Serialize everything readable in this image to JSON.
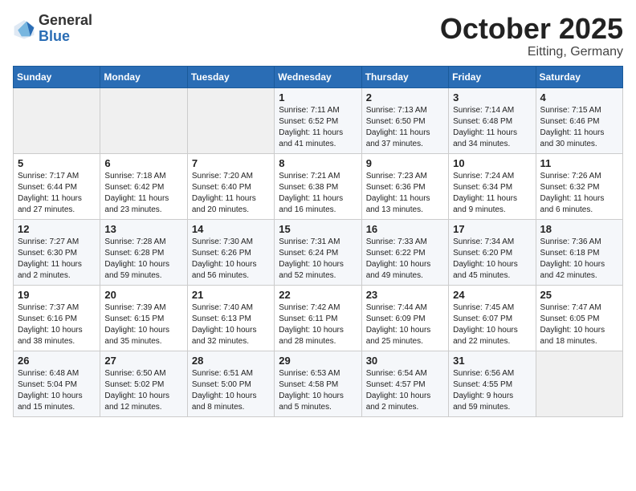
{
  "header": {
    "logo_general": "General",
    "logo_blue": "Blue",
    "month_title": "October 2025",
    "location": "Eitting, Germany"
  },
  "days_of_week": [
    "Sunday",
    "Monday",
    "Tuesday",
    "Wednesday",
    "Thursday",
    "Friday",
    "Saturday"
  ],
  "weeks": [
    [
      {
        "day": "",
        "info": ""
      },
      {
        "day": "",
        "info": ""
      },
      {
        "day": "",
        "info": ""
      },
      {
        "day": "1",
        "info": "Sunrise: 7:11 AM\nSunset: 6:52 PM\nDaylight: 11 hours\nand 41 minutes."
      },
      {
        "day": "2",
        "info": "Sunrise: 7:13 AM\nSunset: 6:50 PM\nDaylight: 11 hours\nand 37 minutes."
      },
      {
        "day": "3",
        "info": "Sunrise: 7:14 AM\nSunset: 6:48 PM\nDaylight: 11 hours\nand 34 minutes."
      },
      {
        "day": "4",
        "info": "Sunrise: 7:15 AM\nSunset: 6:46 PM\nDaylight: 11 hours\nand 30 minutes."
      }
    ],
    [
      {
        "day": "5",
        "info": "Sunrise: 7:17 AM\nSunset: 6:44 PM\nDaylight: 11 hours\nand 27 minutes."
      },
      {
        "day": "6",
        "info": "Sunrise: 7:18 AM\nSunset: 6:42 PM\nDaylight: 11 hours\nand 23 minutes."
      },
      {
        "day": "7",
        "info": "Sunrise: 7:20 AM\nSunset: 6:40 PM\nDaylight: 11 hours\nand 20 minutes."
      },
      {
        "day": "8",
        "info": "Sunrise: 7:21 AM\nSunset: 6:38 PM\nDaylight: 11 hours\nand 16 minutes."
      },
      {
        "day": "9",
        "info": "Sunrise: 7:23 AM\nSunset: 6:36 PM\nDaylight: 11 hours\nand 13 minutes."
      },
      {
        "day": "10",
        "info": "Sunrise: 7:24 AM\nSunset: 6:34 PM\nDaylight: 11 hours\nand 9 minutes."
      },
      {
        "day": "11",
        "info": "Sunrise: 7:26 AM\nSunset: 6:32 PM\nDaylight: 11 hours\nand 6 minutes."
      }
    ],
    [
      {
        "day": "12",
        "info": "Sunrise: 7:27 AM\nSunset: 6:30 PM\nDaylight: 11 hours\nand 2 minutes."
      },
      {
        "day": "13",
        "info": "Sunrise: 7:28 AM\nSunset: 6:28 PM\nDaylight: 10 hours\nand 59 minutes."
      },
      {
        "day": "14",
        "info": "Sunrise: 7:30 AM\nSunset: 6:26 PM\nDaylight: 10 hours\nand 56 minutes."
      },
      {
        "day": "15",
        "info": "Sunrise: 7:31 AM\nSunset: 6:24 PM\nDaylight: 10 hours\nand 52 minutes."
      },
      {
        "day": "16",
        "info": "Sunrise: 7:33 AM\nSunset: 6:22 PM\nDaylight: 10 hours\nand 49 minutes."
      },
      {
        "day": "17",
        "info": "Sunrise: 7:34 AM\nSunset: 6:20 PM\nDaylight: 10 hours\nand 45 minutes."
      },
      {
        "day": "18",
        "info": "Sunrise: 7:36 AM\nSunset: 6:18 PM\nDaylight: 10 hours\nand 42 minutes."
      }
    ],
    [
      {
        "day": "19",
        "info": "Sunrise: 7:37 AM\nSunset: 6:16 PM\nDaylight: 10 hours\nand 38 minutes."
      },
      {
        "day": "20",
        "info": "Sunrise: 7:39 AM\nSunset: 6:15 PM\nDaylight: 10 hours\nand 35 minutes."
      },
      {
        "day": "21",
        "info": "Sunrise: 7:40 AM\nSunset: 6:13 PM\nDaylight: 10 hours\nand 32 minutes."
      },
      {
        "day": "22",
        "info": "Sunrise: 7:42 AM\nSunset: 6:11 PM\nDaylight: 10 hours\nand 28 minutes."
      },
      {
        "day": "23",
        "info": "Sunrise: 7:44 AM\nSunset: 6:09 PM\nDaylight: 10 hours\nand 25 minutes."
      },
      {
        "day": "24",
        "info": "Sunrise: 7:45 AM\nSunset: 6:07 PM\nDaylight: 10 hours\nand 22 minutes."
      },
      {
        "day": "25",
        "info": "Sunrise: 7:47 AM\nSunset: 6:05 PM\nDaylight: 10 hours\nand 18 minutes."
      }
    ],
    [
      {
        "day": "26",
        "info": "Sunrise: 6:48 AM\nSunset: 5:04 PM\nDaylight: 10 hours\nand 15 minutes."
      },
      {
        "day": "27",
        "info": "Sunrise: 6:50 AM\nSunset: 5:02 PM\nDaylight: 10 hours\nand 12 minutes."
      },
      {
        "day": "28",
        "info": "Sunrise: 6:51 AM\nSunset: 5:00 PM\nDaylight: 10 hours\nand 8 minutes."
      },
      {
        "day": "29",
        "info": "Sunrise: 6:53 AM\nSunset: 4:58 PM\nDaylight: 10 hours\nand 5 minutes."
      },
      {
        "day": "30",
        "info": "Sunrise: 6:54 AM\nSunset: 4:57 PM\nDaylight: 10 hours\nand 2 minutes."
      },
      {
        "day": "31",
        "info": "Sunrise: 6:56 AM\nSunset: 4:55 PM\nDaylight: 9 hours\nand 59 minutes."
      },
      {
        "day": "",
        "info": ""
      }
    ]
  ]
}
